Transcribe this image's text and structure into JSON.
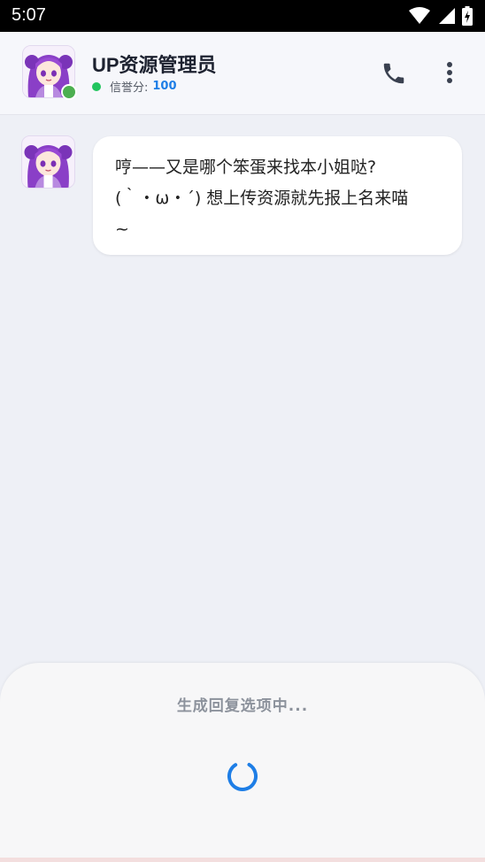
{
  "status_bar": {
    "time": "5:07",
    "icons": [
      "wifi-icon",
      "signal-icon",
      "battery-icon"
    ]
  },
  "header": {
    "title": "UP资源管理员",
    "credit_label": "信誉分:",
    "credit_value": "100",
    "actions": [
      "phone-icon",
      "more-icon"
    ]
  },
  "messages": [
    {
      "sender": "bot",
      "lines": [
        "哼——又是哪个笨蛋来找本小姐哒?",
        "(｀・ω・´) 想上传资源就先报上名来喵",
        "~"
      ]
    }
  ],
  "sheet": {
    "loading_text": "生成回复选项中..."
  },
  "colors": {
    "accent": "#1e7ee6",
    "online": "#22c55e",
    "avatar_hair": "#8a3fc7"
  }
}
